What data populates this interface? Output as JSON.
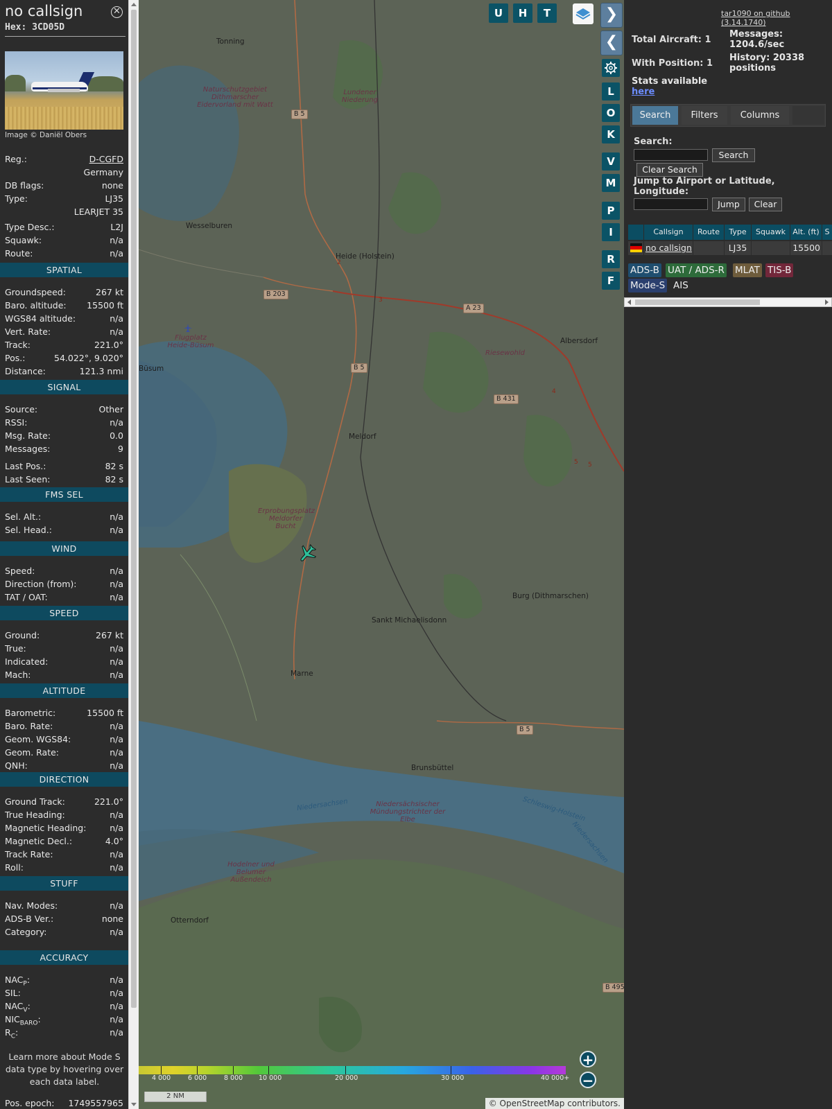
{
  "info": {
    "callsign": "no callsign",
    "hex": "Hex: 3CD05D",
    "photo_credit": "Image © Daniël Obers",
    "details": [
      {
        "k": "Reg.:",
        "v": "D-CGFD",
        "link": true
      },
      {
        "k": "",
        "v": "Germany"
      },
      {
        "k": "DB flags:",
        "v": "none"
      },
      {
        "k": "Type:",
        "v": "LJ35"
      },
      {
        "k": "",
        "v": "LEARJET 35"
      },
      {
        "k": "Type Desc.:",
        "v": "L2J"
      },
      {
        "k": "Squawk:",
        "v": "n/a"
      },
      {
        "k": "Route:",
        "v": "n/a"
      }
    ],
    "sections": [
      {
        "title": "SPATIAL",
        "rows": [
          {
            "k": "Groundspeed:",
            "v": "267 kt"
          },
          {
            "k": "Baro. altitude:",
            "v": "15500 ft"
          },
          {
            "k": "WGS84 altitude:",
            "v": "n/a"
          },
          {
            "k": "Vert. Rate:",
            "v": "n/a"
          },
          {
            "k": "Track:",
            "v": "221.0°"
          },
          {
            "k": "Pos.:",
            "v": "54.022°, 9.020°"
          },
          {
            "k": "Distance:",
            "v": "121.3 nmi"
          }
        ]
      },
      {
        "title": "SIGNAL",
        "rows": [
          {
            "k": "Source:",
            "v": "Other"
          },
          {
            "k": "RSSI:",
            "v": "n/a"
          },
          {
            "k": "Msg. Rate:",
            "v": "0.0"
          },
          {
            "k": "Messages:",
            "v": "9"
          },
          {
            "k": "Last Pos.:",
            "v": "82 s"
          },
          {
            "k": "Last Seen:",
            "v": "82 s"
          }
        ]
      },
      {
        "title": "FMS SEL",
        "rows": [
          {
            "k": "Sel. Alt.:",
            "v": "n/a"
          },
          {
            "k": "Sel. Head.:",
            "v": "n/a"
          }
        ]
      },
      {
        "title": "WIND",
        "rows": [
          {
            "k": "Speed:",
            "v": "n/a"
          },
          {
            "k": "Direction (from):",
            "v": "n/a"
          },
          {
            "k": "TAT / OAT:",
            "v": "n/a"
          }
        ]
      },
      {
        "title": "SPEED",
        "rows": [
          {
            "k": "Ground:",
            "v": "267 kt"
          },
          {
            "k": "True:",
            "v": "n/a"
          },
          {
            "k": "Indicated:",
            "v": "n/a"
          },
          {
            "k": "Mach:",
            "v": "n/a"
          }
        ]
      },
      {
        "title": "ALTITUDE",
        "rows": [
          {
            "k": "Barometric:",
            "v": "15500 ft"
          },
          {
            "k": "Baro. Rate:",
            "v": "n/a"
          },
          {
            "k": "Geom. WGS84:",
            "v": "n/a"
          },
          {
            "k": "Geom. Rate:",
            "v": "n/a"
          },
          {
            "k": "QNH:",
            "v": "n/a"
          }
        ]
      },
      {
        "title": "DIRECTION",
        "rows": [
          {
            "k": "Ground Track:",
            "v": "221.0°"
          },
          {
            "k": "True Heading:",
            "v": "n/a"
          },
          {
            "k": "Magnetic Heading:",
            "v": "n/a"
          },
          {
            "k": "Magnetic Decl.:",
            "v": "4.0°"
          },
          {
            "k": "Track Rate:",
            "v": "n/a"
          },
          {
            "k": "Roll:",
            "v": "n/a"
          }
        ]
      },
      {
        "title": "STUFF",
        "rows": [
          {
            "k": "Nav. Modes:",
            "v": "n/a"
          },
          {
            "k": "ADS-B Ver.:",
            "v": "none"
          },
          {
            "k": "Category:",
            "v": "n/a"
          }
        ]
      },
      {
        "title": "ACCURACY",
        "rows": [
          {
            "k": "NAC",
            "sub": "P",
            "suffix": ":",
            "v": "n/a"
          },
          {
            "k": "SIL:",
            "v": "n/a"
          },
          {
            "k": "NAC",
            "sub": "V",
            "suffix": ":",
            "v": "n/a"
          },
          {
            "k": "NIC",
            "sub": "BARO",
            "suffix": ":",
            "v": "n/a"
          },
          {
            "k": "R",
            "sub": "C",
            "suffix": ":",
            "v": "n/a"
          }
        ]
      }
    ],
    "learn_more": "Learn more about Mode S data type by hovering over each data label.",
    "epoch_label": "Pos. epoch:",
    "epoch_value": "1749557965"
  },
  "map": {
    "places": [
      "Tonning",
      "Wesselburen",
      "Heide (Holstein)",
      "Albersdorf",
      "Büsum",
      "Meldorf",
      "Burg (Dithmarschen)",
      "Sankt Michaelisdonn",
      "Marne",
      "Brunsbüttel",
      "Otterndorf"
    ],
    "nature_labels": [
      "Naturschutzgebiet Dithmarscher Eidervorland mit Watt",
      "Lundener Niederung",
      "Riesewohld",
      "Flugplatz Heide-Büsum",
      "Erprobungsplatz Meldorfer Bucht",
      "Niedersächsischer Mündungstrichter der Elbe",
      "Hodelner und Belumer Außendeich"
    ],
    "water_labels": [
      "Niedersachsen",
      "Schleswig-Holstein",
      "Niedersachsen"
    ],
    "roads": [
      "B 5",
      "B 203",
      "A 23",
      "B 5",
      "B 431",
      "B 5",
      "B 495"
    ],
    "exit_numbers": [
      "2",
      "3",
      "4",
      "5",
      "5"
    ],
    "buttons_top": [
      "U",
      "H",
      "T"
    ],
    "buttons_side": [
      "L",
      "O",
      "K",
      "V",
      "M",
      "P",
      "I",
      "R",
      "F"
    ],
    "nav_forward": "❯",
    "nav_back": "❮",
    "toggle": "◀▶",
    "zoom_in": "+",
    "zoom_out": "−",
    "alt_ticks": [
      "4 000",
      "6 000",
      "8 000",
      "10 000",
      "20 000",
      "30 000",
      "40 000+"
    ],
    "scale_label": "2 NM",
    "osm_credit": "© OpenStreetMap contributors."
  },
  "right": {
    "github": "tar1090 on github (3.14.1740)",
    "total_aircraft": "Total Aircraft: 1",
    "with_position": "With Position: 1",
    "stats_text": "Stats available",
    "stats_link": "here",
    "messages": "Messages: 1204.6/sec",
    "history": "History: 20338 positions",
    "tabs": [
      "Search",
      "Filters",
      "Columns"
    ],
    "search_label": "Search:",
    "search_button": "Search",
    "clear_search_button": "Clear Search",
    "jump_label": "Jump to Airport or Latitude, Longitude:",
    "jump_button": "Jump",
    "clear_button": "Clear",
    "table_headers": [
      "Callsign",
      "Route",
      "Type",
      "Squawk",
      "Alt. (ft)",
      "S"
    ],
    "table_row": {
      "callsign": "no callsign",
      "route": "",
      "type": "LJ35",
      "squawk": "",
      "alt": "15500"
    },
    "sources": [
      {
        "label": "ADS-B",
        "color": "#1f4e6f"
      },
      {
        "label": "UAT / ADS-R",
        "color": "#2d6b3a"
      },
      {
        "label": "MLAT",
        "color": "#6e5c3c"
      },
      {
        "label": "TIS-B",
        "color": "#72273a"
      },
      {
        "label": "Mode-S",
        "color": "#2a3f6e"
      },
      {
        "label": "AIS",
        "color": "#2b2b2b"
      }
    ]
  }
}
